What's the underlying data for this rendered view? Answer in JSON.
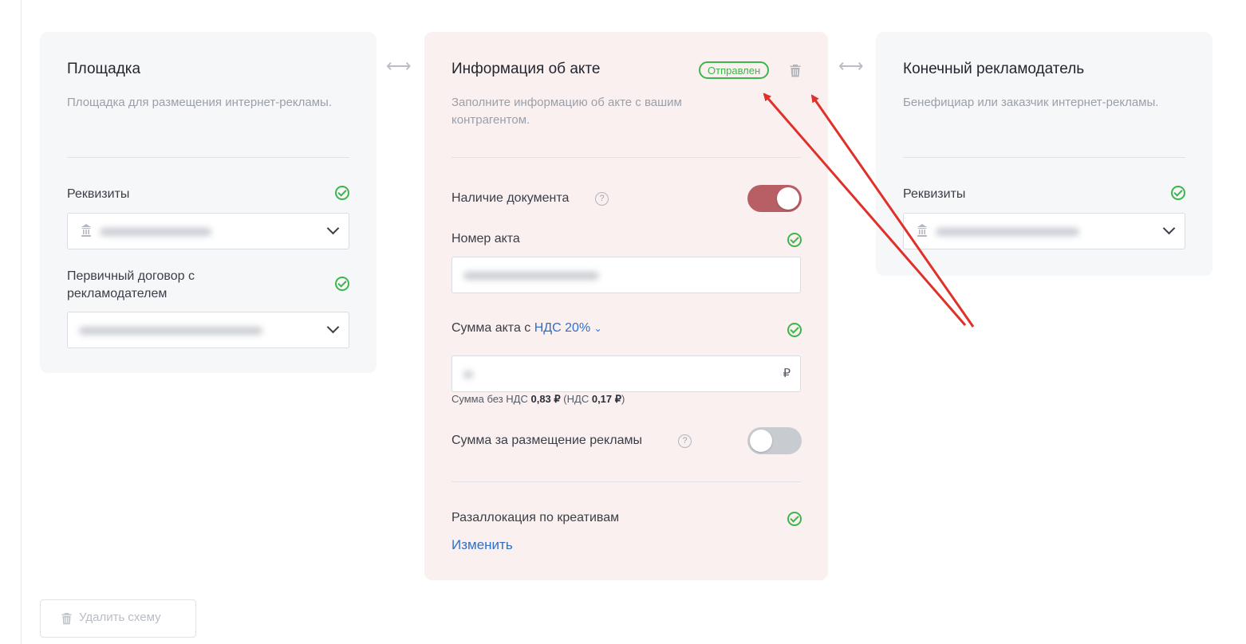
{
  "platform_card": {
    "title": "Площадка",
    "subtitle": "Площадка для размещения интернет-рекламы.",
    "requisites_label": "Реквизиты",
    "contract_label": "Первичный договор с рекламодателем"
  },
  "act_card": {
    "title": "Информация об акте",
    "status_badge": "Отправлен",
    "subtitle": "Заполните информацию об акте с вашим контрагентом.",
    "doc_presence_label": "Наличие документа",
    "act_number_label": "Номер акта",
    "amount_label_prefix": "Сумма акта с",
    "vat_selector": "НДС 20%",
    "currency": "₽",
    "vat_note": {
      "prefix": "Сумма без НДС",
      "net": "0,83 ₽",
      "open": "(НДС",
      "vat": "0,17 ₽",
      "close": ")"
    },
    "ad_placement_label": "Сумма за размещение рекламы",
    "reallocation_label": "Разаллокация по креативам",
    "change_link": "Изменить",
    "help_glyph": "?"
  },
  "advertiser_card": {
    "title": "Конечный рекламодатель",
    "subtitle": "Бенефициар или заказчик интернет-рекламы.",
    "requisites_label": "Реквизиты"
  },
  "footer": {
    "delete_scheme": "Удалить схему"
  },
  "separators": {
    "glyph": "⟷"
  },
  "toggles": {
    "doc_presence_on": true,
    "ad_placement_on": false
  },
  "colors": {
    "success": "#3cb64b",
    "toggle_on": "#b85f66",
    "link": "#2f6fc7",
    "annotation": "#e0302a"
  }
}
